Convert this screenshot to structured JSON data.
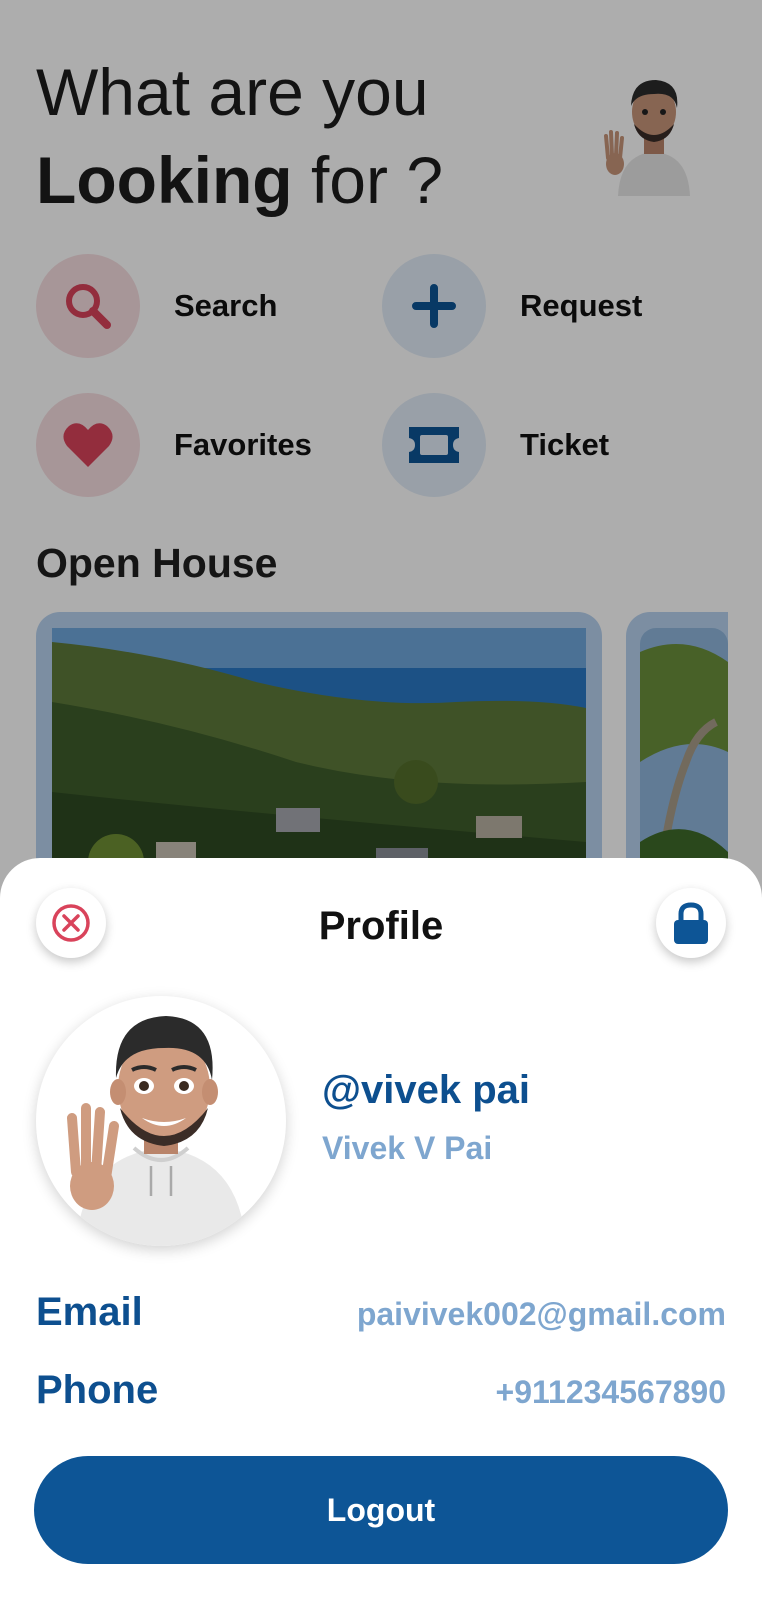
{
  "home": {
    "headline_line1": "What are you",
    "headline_bold": "Looking",
    "headline_rest": " for ?",
    "actions": [
      {
        "label": "Search",
        "icon": "search-icon"
      },
      {
        "label": "Request",
        "icon": "plus-icon"
      },
      {
        "label": "Favorites",
        "icon": "heart-icon"
      },
      {
        "label": "Ticket",
        "icon": "ticket-icon"
      }
    ],
    "section_title": "Open House"
  },
  "profile_sheet": {
    "title": "Profile",
    "close_icon": "close-icon",
    "lock_icon": "lock-icon",
    "handle": "@vivek pai",
    "full_name": "Vivek V Pai",
    "email_label": "Email",
    "email_value": "paivivek002@gmail.com",
    "phone_label": "Phone",
    "phone_value": "+911234567890",
    "logout_label": "Logout"
  },
  "colors": {
    "primary": "#0d5596",
    "label_blue": "#0d4f8f",
    "value_blue": "#7ea6cf",
    "search_tint": "#f7dde1",
    "request_tint": "#e2ecf8",
    "accent_red": "#d9435b"
  }
}
